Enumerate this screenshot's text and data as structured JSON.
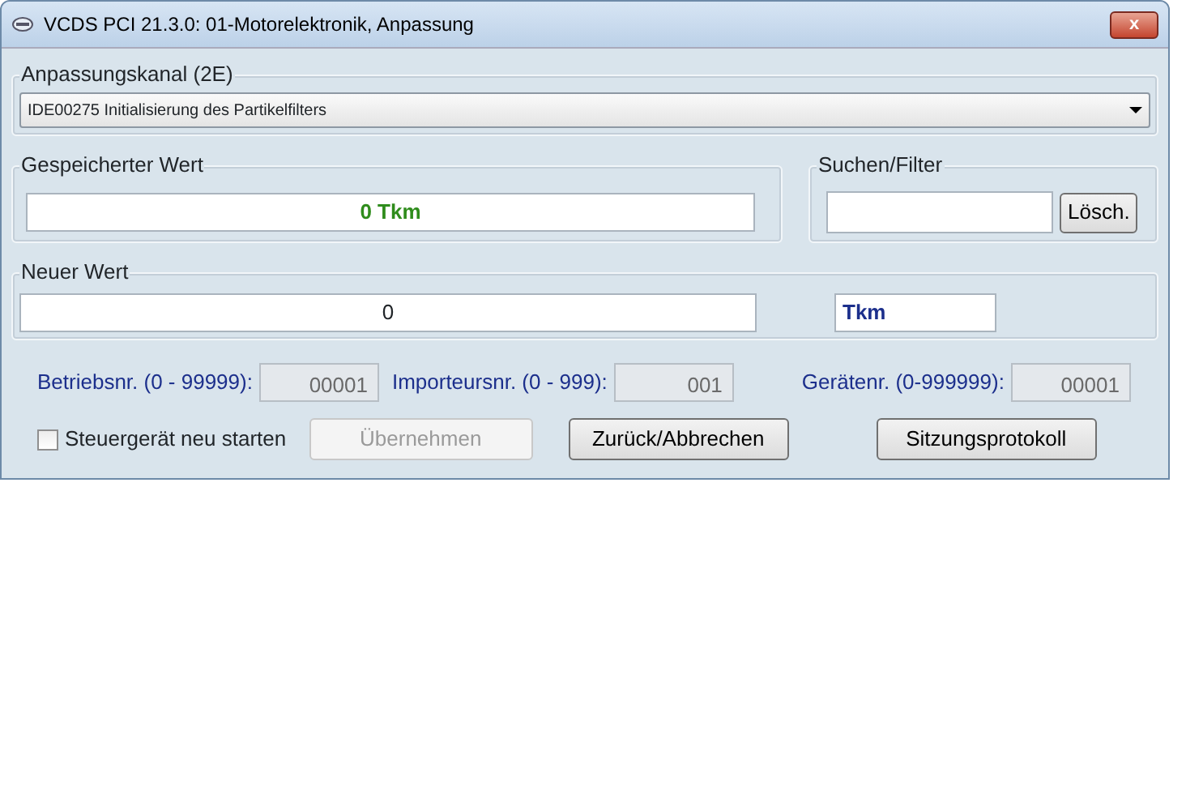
{
  "window": {
    "title": "VCDS PCI 21.3.0: 01-Motorelektronik,  Anpassung",
    "close": "x"
  },
  "channel": {
    "label": "Anpassungskanal (2E)",
    "value": "IDE00275 Initialisierung des Partikelfilters"
  },
  "stored": {
    "label": "Gespeicherter Wert",
    "value": "0 Tkm"
  },
  "search": {
    "label": "Suchen/Filter",
    "button": "Lösch."
  },
  "new_value": {
    "label": "Neuer Wert",
    "value": "0",
    "unit": "Tkm"
  },
  "codes": [
    {
      "label": "Betriebsnr. (0 - 99999):",
      "value": "00001"
    },
    {
      "label": "Importeursnr. (0 - 999):",
      "value": "001"
    },
    {
      "label": "Gerätenr. (0-999999):",
      "value": "00001"
    }
  ],
  "restart": {
    "label": "Steuergerät neu starten",
    "checked": false
  },
  "buttons": [
    {
      "label": "Übernehmen",
      "disabled": true
    },
    {
      "label": "Zurück/Abbrechen",
      "disabled": false
    },
    {
      "label": "Sitzungsprotokoll",
      "disabled": false
    }
  ]
}
